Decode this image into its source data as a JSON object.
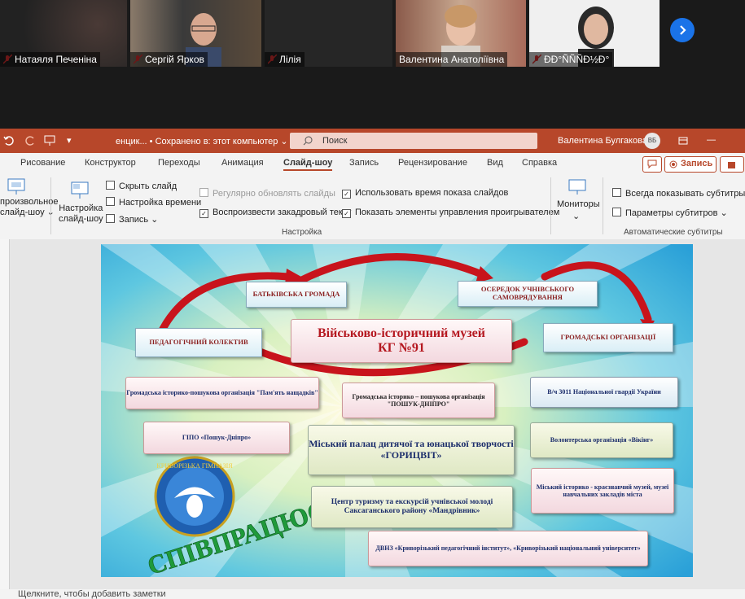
{
  "participants": [
    {
      "name": "Натаяля Печеніна",
      "active": false
    },
    {
      "name": "Сергій Ярков",
      "active": false
    },
    {
      "name": "Лілія",
      "active": false
    },
    {
      "name": "Валентина Анатоліївна",
      "active": true
    },
    {
      "name": "ÐÐ°ÑÑÑÐ½Ð°",
      "active": false
    }
  ],
  "titlebar": {
    "doc_name": "енцик... • Сохранено в: этот компьютер ⌄",
    "search_placeholder": "Поиск",
    "user_name": "Валентина Булгакова",
    "user_initials": "ВБ"
  },
  "tabs": [
    "Рисование",
    "Конструктор",
    "Переходы",
    "Анимация",
    "Слайд-шоу",
    "Запись",
    "Рецензирование",
    "Вид",
    "Справка"
  ],
  "selected_tab": "Слайд-шоу",
  "ribbon": {
    "custom_show": "произвольное\nслайд-шоу ⌄",
    "setup_show": "Настройка\nслайд-шоу",
    "hide_slide": "Скрыть слайд",
    "timing": "Настройка времени",
    "record": "Запись",
    "keep_updated": "Регулярно обновлять слайды",
    "play_narration": "Воспроизвести закадровый текст",
    "use_timings": "Использовать время показа слайдов",
    "show_controls": "Показать элементы управления проигрывателем",
    "group_settings": "Настройка",
    "monitors": "Мониторы",
    "always_subtitles": "Всегда показывать субтитры",
    "subtitle_params": "Параметры субтитров ⌄",
    "group_subtitles": "Автоматические субтитры",
    "record_btn": "Запись"
  },
  "notes_placeholder": "Щелкните, чтобы добавить заметки",
  "slide": {
    "title_line1": "Військово-історичний музей",
    "title_line2": "КГ №91",
    "ribbons": [
      "БАТЬКІВСЬКА ГРОМАДА",
      "ОСЕРЕДОК УЧНІВСЬКОГО САМОВРЯДУВАННЯ",
      "ПЕДАГОГІЧНИЙ КОЛЕКТИВ",
      "ГРОМАДСЬКІ ОРГАНІЗАЦІЇ"
    ],
    "orgs": [
      "Громадська історико-пошукова організація \"Пам'ять нащадків\"",
      "Громадська історико – пошукова організація \"ПОШУК-ДНІПРО\"",
      "В/ч 3011 Національної гвардії України",
      "ГІПО «Пошук-Дніпро»",
      "Міський палац дитячої та юнацької творчості «ГОРИЦВІТ»",
      "Волонтерська організація «Вікінг»",
      "Центр туризму та екскурсій учнівської молоді Саксаганського району «Мандрівник»",
      "Міський історико - краєзнавчий музей, музеї навчальних закладів міста",
      "ДВНЗ «Криворізький педагогічний інститут», «Криворізький національний університет»"
    ],
    "word": "СПІВПРАЦЮЄ",
    "logo_text": "КРИВОРІЗЬКА ГІМНАЗІЯ"
  }
}
